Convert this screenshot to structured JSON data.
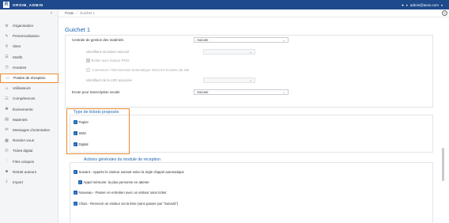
{
  "topbar": {
    "logo_letter": "R",
    "brand": "ORSIM_ADMIN",
    "user_label": "admin@aexs.com",
    "info_icon": "info-icon",
    "caret_icon": "chevron-down-icon"
  },
  "colors": {
    "topbar": "#1e4a8c",
    "accent": "#1e64b4",
    "highlight": "#ee8a2a"
  },
  "sidebar": {
    "collapse_icon": "chevron-left-icon",
    "items": [
      {
        "label": "Organisation",
        "icon": "gear-icon",
        "glyph": "⚙"
      },
      {
        "label": "Personnalisation",
        "icon": "brush-icon",
        "glyph": "✎"
      },
      {
        "label": "Sites",
        "icon": "location-pin-icon",
        "glyph": "⚲"
      },
      {
        "label": "Motifs",
        "icon": "list-icon",
        "glyph": "☰"
      },
      {
        "label": "Horaires",
        "icon": "clock-icon",
        "glyph": "◷"
      },
      {
        "label": "Postes de réception",
        "icon": "desk-icon",
        "glyph": "▭",
        "active": true
      },
      {
        "label": "Utilisateurs",
        "icon": "user-icon",
        "glyph": "☺"
      },
      {
        "label": "Compétences",
        "icon": "skills-icon",
        "glyph": "☷"
      },
      {
        "label": "Événements",
        "icon": "event-icon",
        "glyph": "✺"
      },
      {
        "label": "Matériels",
        "icon": "device-icon",
        "glyph": "▤"
      },
      {
        "label": "Messages d'orientation",
        "icon": "message-icon",
        "glyph": "✉"
      },
      {
        "label": "Rendez-vous",
        "icon": "calendar-icon",
        "glyph": "▦"
      },
      {
        "label": "Ticket digital",
        "icon": "phone-icon",
        "glyph": "✆"
      },
      {
        "label": "Files uniques",
        "icon": "queue-icon",
        "glyph": "⫶"
      },
      {
        "label": "Retrait auteurs",
        "icon": "users-icon",
        "glyph": "☻"
      },
      {
        "label": "Import",
        "icon": "import-icon",
        "glyph": "⇩"
      }
    ]
  },
  "breadcrumb": {
    "root": "Poste",
    "separator": "/",
    "current": "Guichet 1",
    "help_icon": "help-icon"
  },
  "page_title": "Guichet 1",
  "material": {
    "center_label": "Centrale de gestion des matériels",
    "center_value": "Aucune",
    "device_id_label": "Identifiant du boitier associé",
    "device_id_value": "",
    "use_port_label": "Boitier avec bouton RFID",
    "option_label": "Connexion / Déconnexion automatique selon les horaires du site",
    "led_label": "Identifiant de la LED associée",
    "led_value": "",
    "screen_label": "Ecran pour transcription vocale",
    "screen_value": "Aucune"
  },
  "tickets": {
    "legend": "Type de tickets proposés",
    "options": [
      "Papier",
      "SMS",
      "Digital"
    ]
  },
  "actions": {
    "legend": "Actions générales du module de réception",
    "options": [
      "Suivant - Appeler le visiteur suivant selon la règle d'appel automatique",
      "Appel mémoire: la plus personne en attente",
      "Nouveau - Passer en entretien avec un visiteur sans ticket",
      "Choix - Recevoir un visiteur via la liste (sans passer par \"Suivant\")"
    ]
  }
}
